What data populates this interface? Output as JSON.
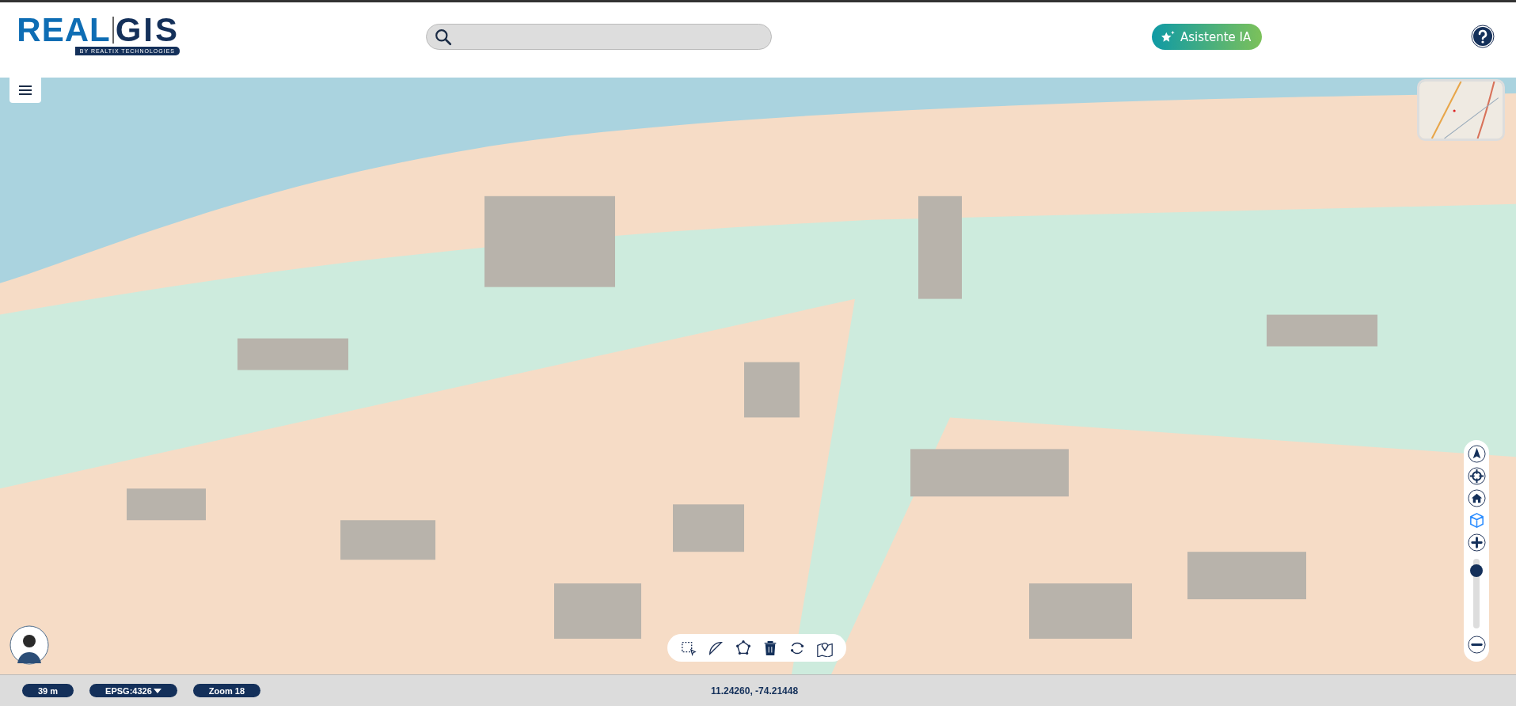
{
  "header": {
    "logo": {
      "part_1": "REAL",
      "part_2": "GIS",
      "tagline": "BY REALTIX TECHNOLOGIES"
    },
    "assistant_button": {
      "label": "Asistente IA"
    }
  },
  "map_controls": {
    "view_3d": {
      "on": true
    },
    "zoom_slider": {
      "level": 0.9
    }
  },
  "status_bar": {
    "scale": "39 m",
    "projection": "EPSG:4326",
    "zoom": "Zoom 18",
    "coordinates": "11.24260, -74.21448"
  }
}
